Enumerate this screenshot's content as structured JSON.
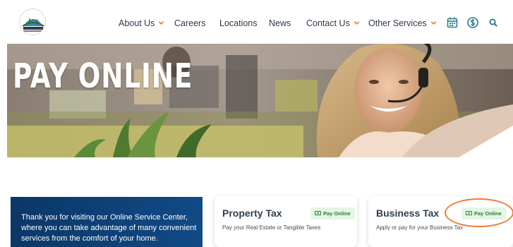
{
  "header": {
    "logo_icon": "tax-collector-logo",
    "nav": [
      {
        "label": "About Us",
        "dropdown": true
      },
      {
        "label": "Careers",
        "dropdown": false
      },
      {
        "label": "Locations",
        "dropdown": false
      },
      {
        "label": "News",
        "dropdown": false
      },
      {
        "label": "Contact Us",
        "dropdown": true
      },
      {
        "label": "Other Services",
        "dropdown": true
      }
    ],
    "icons": [
      "calendar-icon",
      "dollar-icon",
      "search-icon"
    ],
    "accent_color": "#e8832a",
    "icon_color": "#2f7d8c"
  },
  "hero": {
    "title": "PAY ONLINE"
  },
  "intro": {
    "text": "Thank you for visiting our Online Service Center, where you can take advantage of many convenient services from the comfort of your home."
  },
  "cards": [
    {
      "title": "Property Tax",
      "subtitle": "Pay your Real Estate or Tangible Taxes",
      "button": "Pay Online"
    },
    {
      "title": "Business Tax",
      "subtitle": "Apply or pay for your Business Tax",
      "button": "Pay Online"
    }
  ],
  "colors": {
    "intro_bg": "#0b3767",
    "pay_button_bg": "#e5f5e4",
    "pay_button_text": "#2e7d32",
    "highlight": "#ed7d31"
  }
}
